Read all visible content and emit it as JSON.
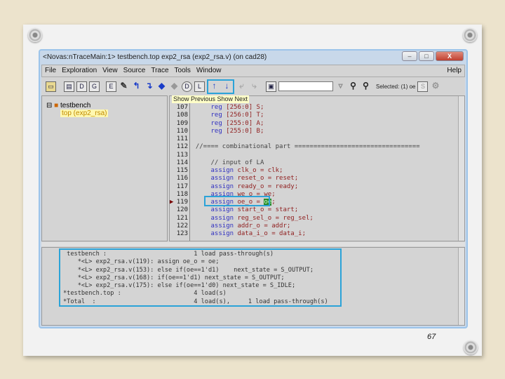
{
  "window": {
    "title": "<Novas:nTraceMain:1> testbench.top exp2_rsa (exp2_rsa.v) (on cad28)",
    "buttons": [
      "–",
      "□",
      "X"
    ]
  },
  "menu": [
    "File",
    "Exploration",
    "View",
    "Source",
    "Trace",
    "Tools",
    "Window"
  ],
  "menu_help": "Help",
  "toolbar": {
    "selected": "Selected: (1) oe",
    "find_value": "",
    "prev_icon": "↑",
    "next_icon": "↓"
  },
  "tooltip": "Show Previous Show Next",
  "tree": {
    "root": "testbench",
    "child": "top (exp2_rsa)"
  },
  "code": [
    {
      "n": "107",
      "kw": "reg",
      "rest": " [256:0] S;"
    },
    {
      "n": "108",
      "kw": "reg",
      "rest": " [256:0] T;"
    },
    {
      "n": "109",
      "kw": "reg",
      "rest": " [255:0] A;"
    },
    {
      "n": "110",
      "kw": "reg",
      "rest": " [255:0] B;"
    },
    {
      "n": "111",
      "kw": "",
      "rest": ""
    },
    {
      "n": "112",
      "kw": "",
      "rest": "//==== combinational part ================================="
    },
    {
      "n": "113",
      "kw": "",
      "rest": ""
    },
    {
      "n": "114",
      "kw": "",
      "rest": "    // input of LA"
    },
    {
      "n": "115",
      "kw": "assign",
      "rest": " clk_o = clk;"
    },
    {
      "n": "116",
      "kw": "assign",
      "rest": " reset_o = reset;"
    },
    {
      "n": "117",
      "kw": "assign",
      "rest": " ready_o = ready;"
    },
    {
      "n": "118",
      "kw": "assign",
      "rest": " we_o = we;"
    },
    {
      "n": "119",
      "kw": "assign",
      "rest": " oe_o = ",
      "hl": "oe",
      "tail": ";"
    },
    {
      "n": "120",
      "kw": "assign",
      "rest": " start_o = start;"
    },
    {
      "n": "121",
      "kw": "assign",
      "rest": " reg_sel_o = reg_sel;"
    },
    {
      "n": "122",
      "kw": "assign",
      "rest": " addr_o = addr;"
    },
    {
      "n": "123",
      "kw": "assign",
      "rest": " data_i_o = data_i;"
    }
  ],
  "trace": [
    " testbench :                        1 load pass-through(s)",
    "    *<L> exp2_rsa.v(119): assign oe_o = oe;",
    "    *<L> exp2_rsa.v(153): else if(oe==1'd1)    next_state = S_OUTPUT;",
    "    *<L> exp2_rsa.v(168): if(oe==1'd1) next_state = S_OUTPUT;",
    "    *<L> exp2_rsa.v(175): else if(oe==1'd0) next_state = S_IDLE;",
    "*testbench.top :                    4 load(s)",
    "*Total  :                           4 load(s),     1 load pass-through(s)"
  ],
  "page_number": "67"
}
